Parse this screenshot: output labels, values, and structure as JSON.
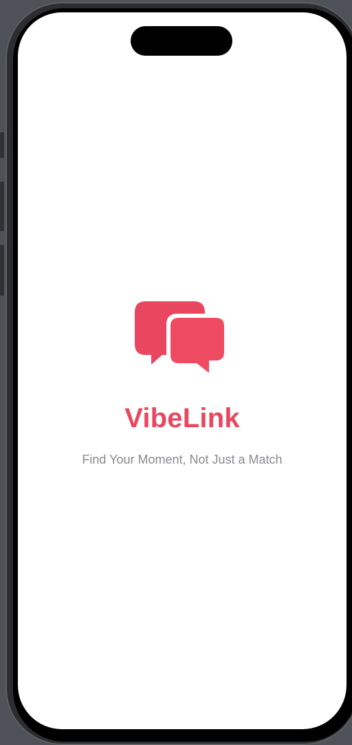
{
  "app": {
    "name": "VibeLink",
    "tagline": "Find Your Moment, Not Just a Match",
    "logo_icon": "chat-bubbles-icon"
  },
  "colors": {
    "accent": "#e8475f",
    "tagline": "#8a8a8e",
    "screen_background": "#ffffff",
    "outer_background": "#4e5258"
  }
}
